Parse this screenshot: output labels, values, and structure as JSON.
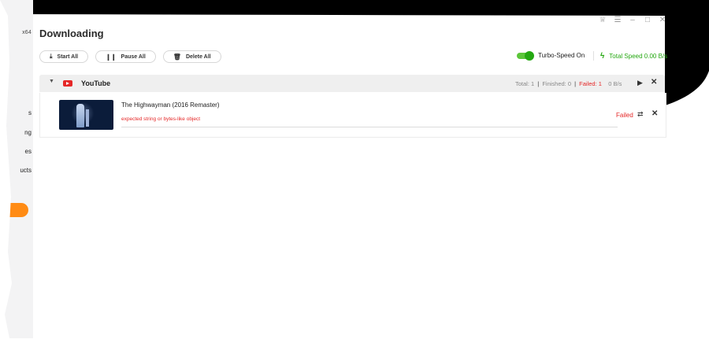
{
  "sidebar": {
    "arch": "x64",
    "nav_partial": [
      "s",
      "ng",
      "es",
      "ucts"
    ]
  },
  "window": {
    "controls": [
      "♕",
      "☰",
      "–",
      "□",
      "✕"
    ]
  },
  "page": {
    "title": "Downloading"
  },
  "toolbar": {
    "start_all": "Start All",
    "pause_all": "Pause All",
    "delete_all": "Delete All"
  },
  "turbo": {
    "label": "Turbo-Speed On",
    "enabled": true
  },
  "speed": {
    "label": "Total Speed 0.00 B/s"
  },
  "group": {
    "name": "YouTube",
    "total": "Total: 1",
    "finished": "Finished: 0",
    "failed": "Failed: 1",
    "rate": "0 B/s"
  },
  "item": {
    "title": "The Highwayman (2016 Remaster)",
    "error": "expected string or bytes-like object",
    "status": "Failed"
  },
  "colors": {
    "accent": "#ff8b14",
    "success": "#25a812",
    "error": "#e52727"
  }
}
